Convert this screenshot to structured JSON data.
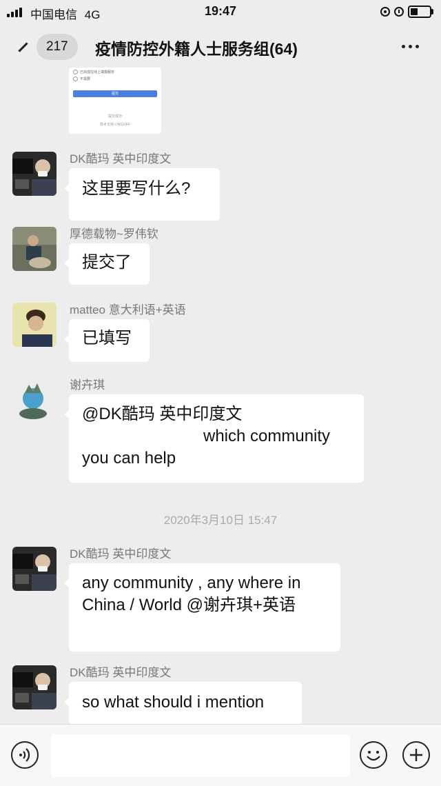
{
  "status_bar": {
    "carrier": "中国电信",
    "network": "4G",
    "time": "19:47"
  },
  "nav": {
    "unread_count": "217",
    "title": "疫情防控外籍人士服务组(64)"
  },
  "shared_image": {
    "option_1": "已完成在线上填报服务",
    "option_2": "不需要",
    "button_label": "提交",
    "footer_1": "提交成功",
    "footer_2": "技术支持 LINGXIFF"
  },
  "messages": [
    {
      "sender": "DK酷玛 英中印度文",
      "text": "这里要写什么?"
    },
    {
      "sender": "厚德载物~罗伟钦",
      "text": "提交了"
    },
    {
      "sender": "matteo 意大利语+英语",
      "text": "已填写"
    },
    {
      "sender": "谢卉琪",
      "line1": "@DK酷玛 英中印度文",
      "line2": "which community",
      "line3": "you can help"
    },
    {
      "sender": "DK酷玛 英中印度文",
      "line1": "any community , any where in",
      "line2": "China / World @谢卉琪+英语"
    },
    {
      "sender": "DK酷玛 英中印度文",
      "text": "so what should i mention"
    }
  ],
  "timestamp": "2020年3月10日 15:47",
  "icons": {
    "voice": "voice-icon",
    "emoji": "emoji-icon",
    "plus": "plus-icon",
    "back": "chevron-left-icon",
    "more": "more-icon"
  }
}
